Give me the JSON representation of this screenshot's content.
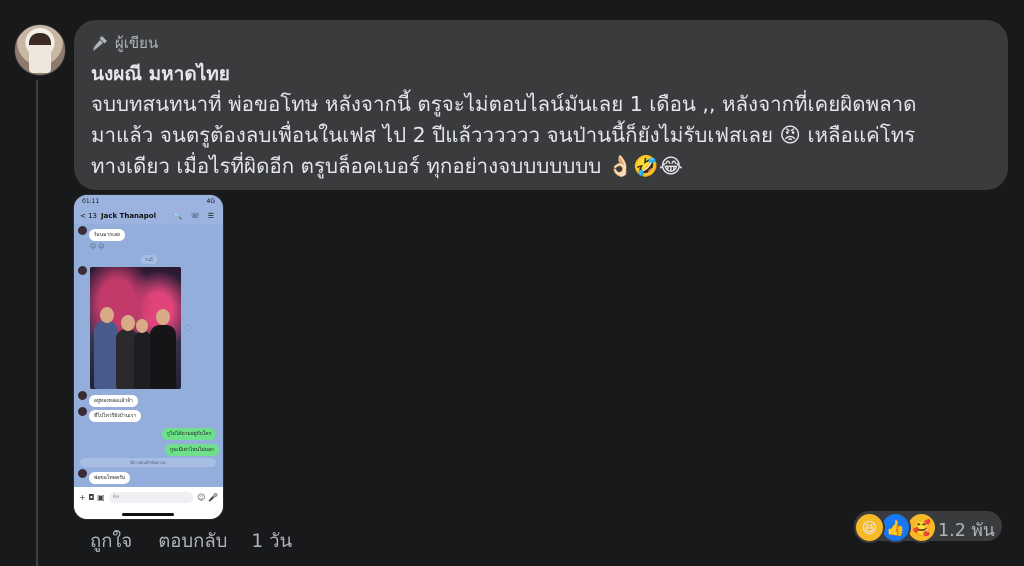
{
  "comment": {
    "badge": "ผู้เขียน",
    "author": "นงผณี มหาดไทย",
    "lines": [
      "จบบทสนทนาที่ พ่อขอโทษ หลังจากนี้ ตรูจะไม่ตอบไลน์มันเลย 1 เดือน ,, หลังจากที่เคยผิดพลาด",
      "มาแล้ว จนตรูต้องลบเพื่อนในเฟส ไป 2 ปีแล้วววววว จนป่านนี้ก็ยังไม่รับเฟสเลย 😡 เหลือแค่โทร",
      "ทางเดียว เมื่อไรที่ผิดอีก ตรูบล็อคเบอร์ ทุกอย่างจบบบบบบบ 👌🏻🤣😂"
    ]
  },
  "screenshot": {
    "time": "01:11",
    "signal": "4G",
    "back_count": "< 13",
    "contact": "Jack Thanapol",
    "header_icons": "🔍 ☏ ☰",
    "msg1": "ร้อนมากเลย",
    "sticker": "😊 ☺",
    "date_chip": "วันนี้",
    "msg2": "อยู่ทองหล่อแล้วจ้า",
    "msg3": "ที่ไปไหวรึยังบ้านเรา",
    "reply1": "กูไม่ได้ถามอยู่กับใคร",
    "reply2": "กูจะมีเท่าไหนไม่บอก",
    "system_line": "มีการยกเลิกข้อความ",
    "msg4": "พ่อขอโทษครับ",
    "input_placeholder": "Aa",
    "input_icons_left": "+ ◘ ▣",
    "input_icons_right": "☺ 🎤"
  },
  "actions": {
    "like": "ถูกใจ",
    "reply": "ตอบกลับ",
    "time": "1 วัน"
  },
  "reactions": {
    "icons": [
      "haha",
      "like",
      "care"
    ],
    "glyphs": [
      "😆",
      "👍",
      "🥰"
    ],
    "count": "1.2 พัน"
  },
  "colors": {
    "background": "#18191a",
    "bubble": "#3a3b3c",
    "text": "#e4e6eb",
    "secondary": "#b0b3b8",
    "like_blue": "#1877f2"
  }
}
